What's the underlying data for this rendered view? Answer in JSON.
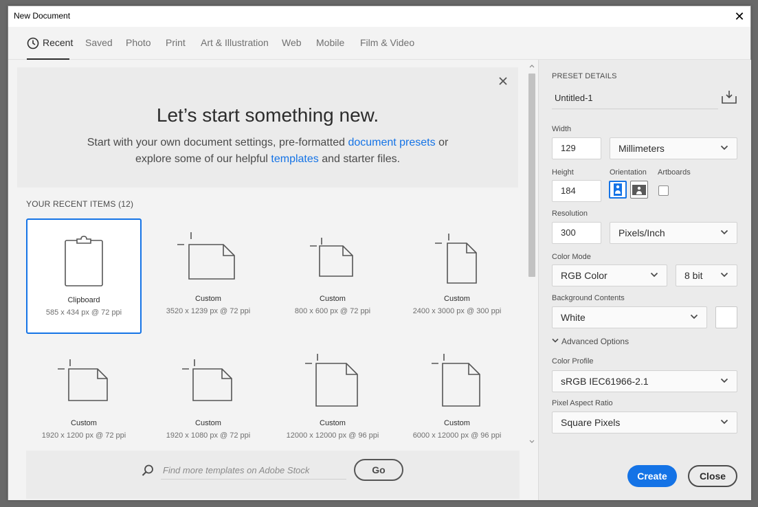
{
  "window": {
    "title": "New Document",
    "close_icon": "close-icon"
  },
  "tabs": [
    "Recent",
    "Saved",
    "Photo",
    "Print",
    "Art & Illustration",
    "Web",
    "Mobile",
    "Film & Video"
  ],
  "hero": {
    "title": "Let’s start something new.",
    "line1_pre": "Start with your own document settings, pre-formatted ",
    "line1_link": "document presets",
    "line1_post": " or",
    "line2_pre": "explore some of our helpful ",
    "line2_link": "templates",
    "line2_post": " and starter files."
  },
  "recent": {
    "heading": "YOUR RECENT ITEMS",
    "count": "(12)",
    "items": [
      {
        "name": "Clipboard",
        "dims": "585 x 434 px @ 72 ppi",
        "icon": "clipboard-icon"
      },
      {
        "name": "Custom",
        "dims": "3520 x 1239 px @ 72 ppi",
        "icon": "landscape-document-icon"
      },
      {
        "name": "Custom",
        "dims": "800 x 600 px @ 72 ppi",
        "icon": "landscape-document-icon"
      },
      {
        "name": "Custom",
        "dims": "2400 x 3000 px @ 300 ppi",
        "icon": "portrait-document-icon"
      },
      {
        "name": "Custom",
        "dims": "1920 x 1200 px @ 72 ppi",
        "icon": "landscape-document-icon"
      },
      {
        "name": "Custom",
        "dims": "1920 x 1080 px @ 72 ppi",
        "icon": "landscape-document-icon"
      },
      {
        "name": "Custom",
        "dims": "12000 x 12000 px @ 96 ppi",
        "icon": "square-document-icon"
      },
      {
        "name": "Custom",
        "dims": "6000 x 12000 px @ 96 ppi",
        "icon": "portrait-document-icon"
      }
    ]
  },
  "stock": {
    "placeholder": "Find more templates on Adobe Stock",
    "go_label": "Go"
  },
  "preset": {
    "heading": "PRESET DETAILS",
    "name": "Untitled-1",
    "width_label": "Width",
    "width": "129",
    "width_unit": "Millimeters",
    "height_label": "Height",
    "height": "184",
    "orientation_label": "Orientation",
    "artboards_label": "Artboards",
    "resolution_label": "Resolution",
    "resolution": "300",
    "resolution_unit": "Pixels/Inch",
    "color_mode_label": "Color Mode",
    "color_mode": "RGB Color",
    "bit_depth": "8 bit",
    "bg_label": "Background Contents",
    "bg": "White",
    "bg_color": "#ffffff",
    "advanced_label": "Advanced Options",
    "profile_label": "Color Profile",
    "profile": "sRGB IEC61966-2.1",
    "par_label": "Pixel Aspect Ratio",
    "par": "Square Pixels",
    "create_label": "Create",
    "close_label": "Close"
  },
  "colors": {
    "accent": "#1473e6"
  }
}
